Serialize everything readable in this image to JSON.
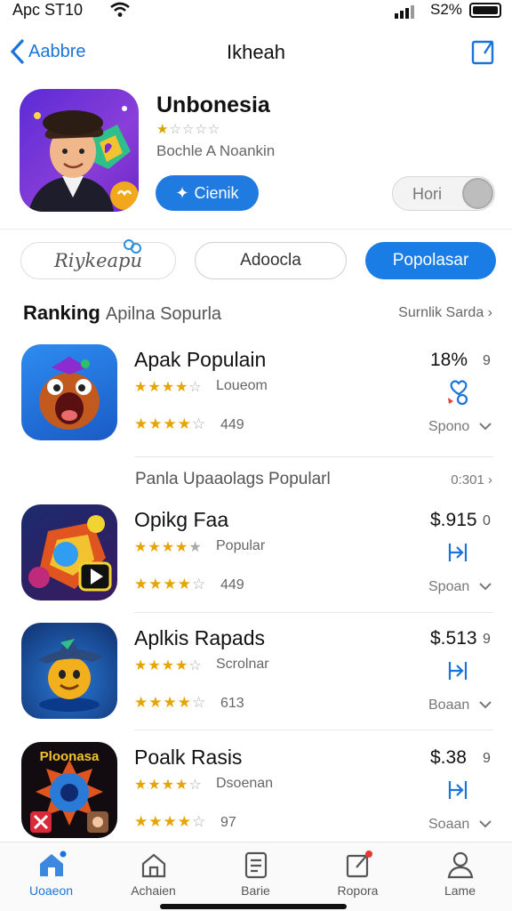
{
  "status": {
    "time": "Apc ST10",
    "battery_pct": "S2%"
  },
  "nav": {
    "back_label": "Aabbre",
    "title": "Ikheah"
  },
  "hero": {
    "name": "Unbonesia",
    "rating_stars": "★",
    "rating_empty": "☆☆☆☆",
    "subtitle": "Bochle A Noankin",
    "get_label": "Cienik",
    "toggle_label": "Hori"
  },
  "filters": [
    {
      "label": "Riykeapu"
    },
    {
      "label": "Adoocla"
    },
    {
      "label": "Popolasar"
    }
  ],
  "section": {
    "title": "Ranking",
    "subtitle": "Apilna Sopurla",
    "link": "Surnlik Sarda"
  },
  "sub_section": {
    "title": "Panla Upaaolags Popularl",
    "meta": "0:301"
  },
  "apps": [
    {
      "title": "Apak Populain",
      "stars_top": "★★★★",
      "stars_top_empty": "☆",
      "sub": "Loueom",
      "stars_bottom": "★★★★",
      "stars_bottom_empty": "☆",
      "count": "449",
      "price": "18%",
      "price_extra": "9",
      "more": "Spono"
    },
    {
      "title": "Opikg Faa",
      "stars_top": "★★★★",
      "stars_top_empty": "★",
      "sub": "Popular",
      "stars_bottom": "★★★★",
      "stars_bottom_empty": "☆",
      "count": "449",
      "price": "$.915",
      "price_extra": "0",
      "more": "Spoan"
    },
    {
      "title": "Aplkis Rapads",
      "stars_top": "★★★★",
      "stars_top_empty": "☆",
      "sub": "Scrolnar",
      "stars_bottom": "★★★★",
      "stars_bottom_empty": "☆",
      "count": "613",
      "price": "$.513",
      "price_extra": "9",
      "more": "Boaan"
    },
    {
      "title": "Poalk Rasis",
      "stars_top": "★★★★",
      "stars_top_empty": "☆",
      "sub": "Dsoenan",
      "stars_bottom": "★★★★",
      "stars_bottom_empty": "☆",
      "count": "97",
      "price": "$.38",
      "price_extra": "9",
      "more": "Soaan"
    }
  ],
  "app4_icon_text": "Ploonasa",
  "tabs": [
    {
      "label": "Uoaeon"
    },
    {
      "label": "Achaien"
    },
    {
      "label": "Barie"
    },
    {
      "label": "Ropora"
    },
    {
      "label": "Lame"
    }
  ],
  "colors": {
    "accent": "#1a7de6",
    "star": "#e6a400",
    "text": "#111111"
  }
}
